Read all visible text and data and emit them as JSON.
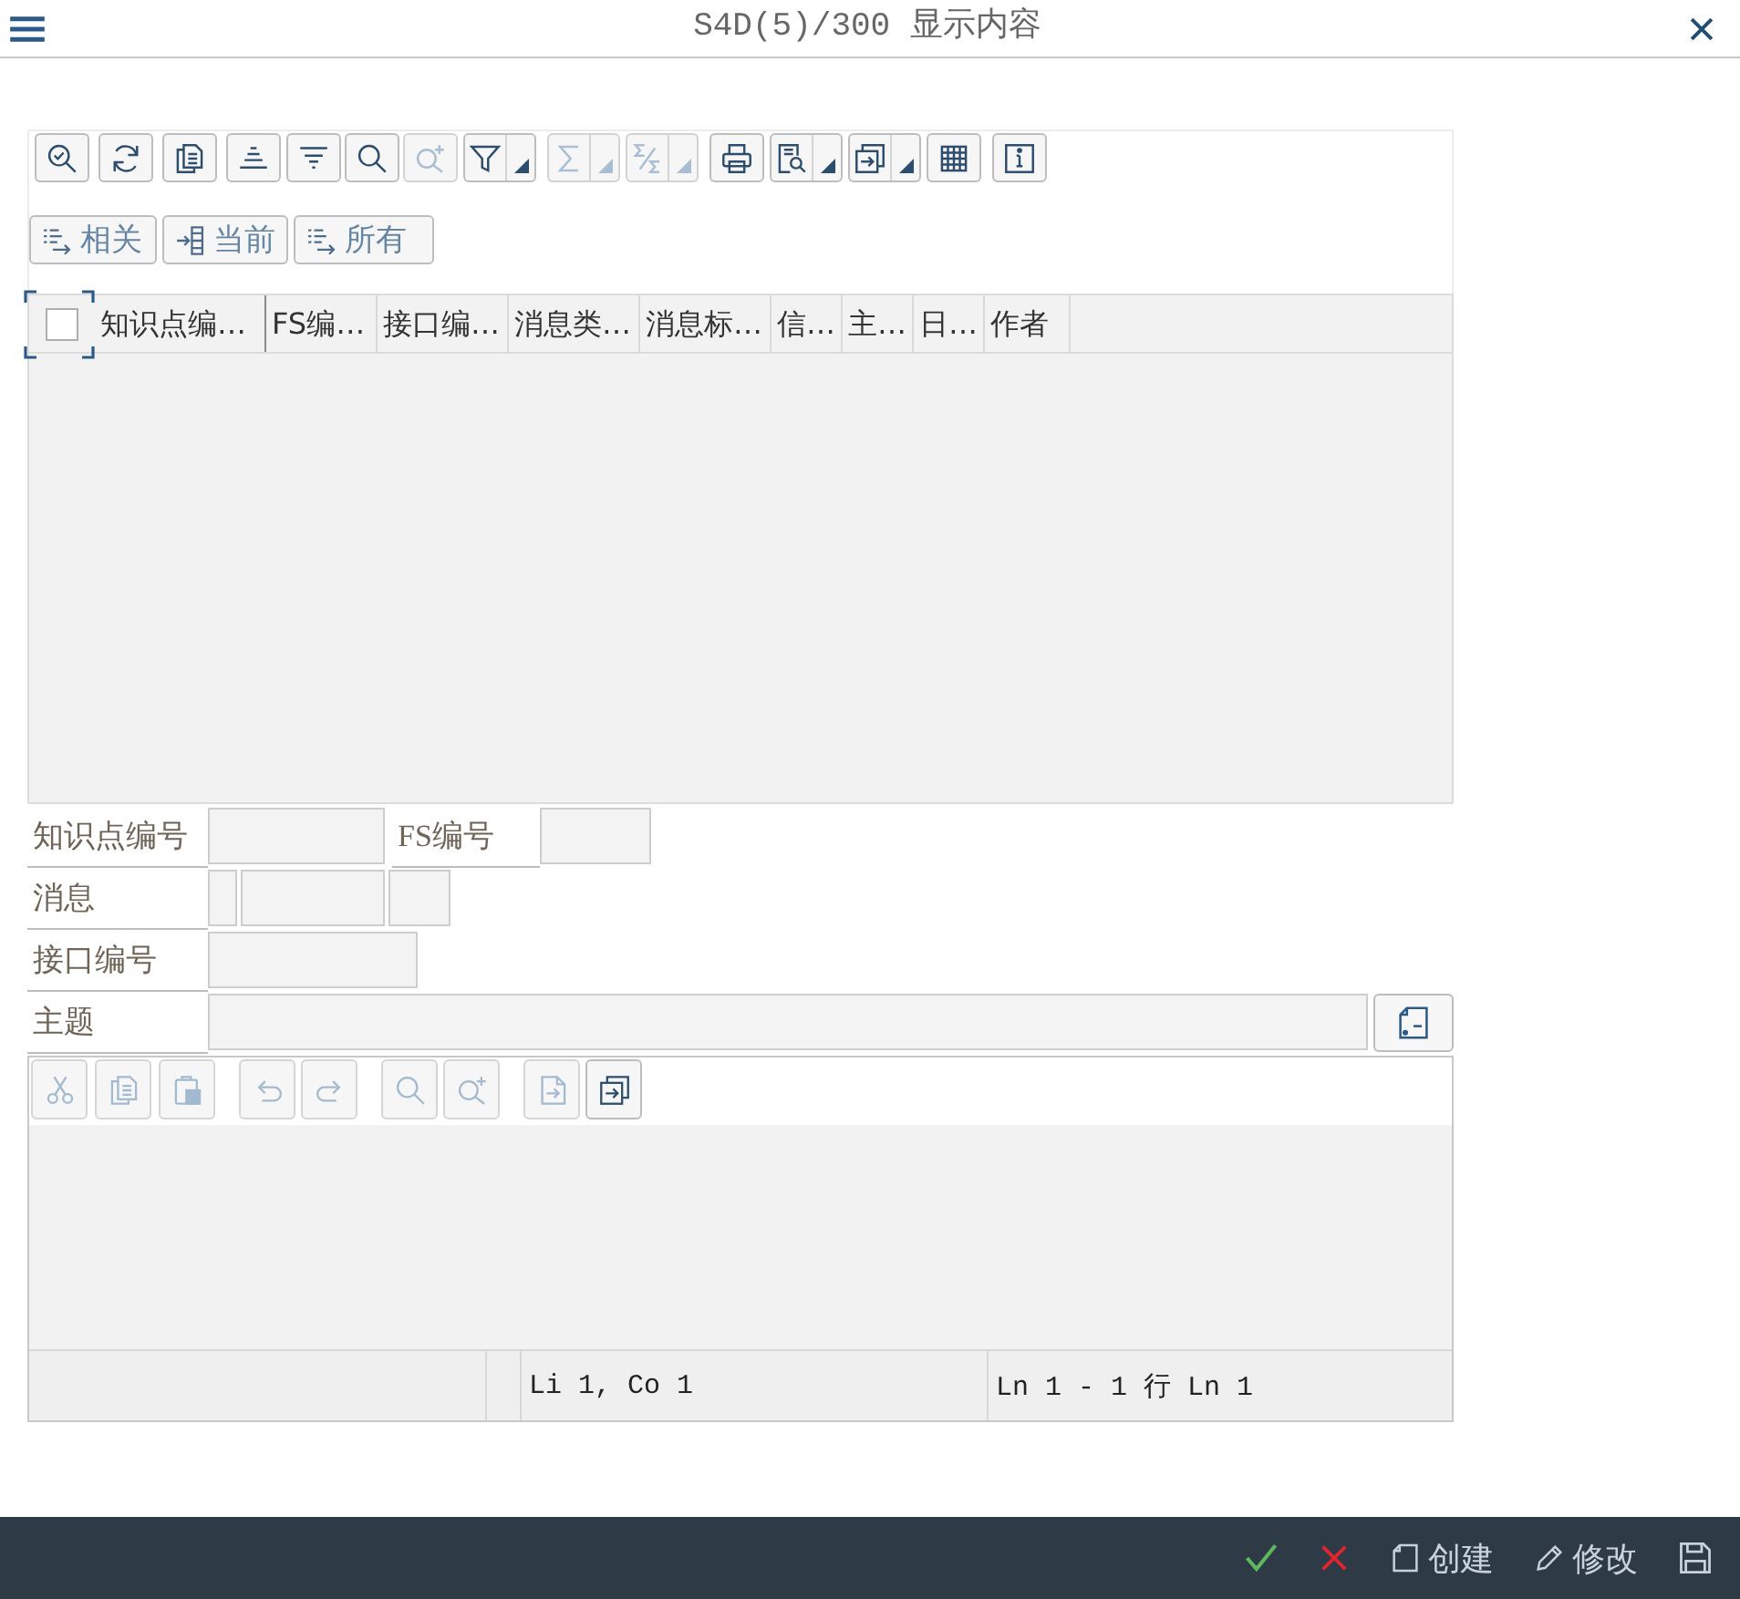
{
  "window": {
    "title": "S4D(5)/300 显示内容"
  },
  "toolbar": [
    {
      "kind": "button",
      "disabled": false
    },
    {
      "kind": "button",
      "disabled": false
    },
    {
      "kind": "button",
      "disabled": false
    },
    {
      "kind": "button",
      "disabled": false
    },
    {
      "kind": "button",
      "disabled": false
    },
    {
      "kind": "button",
      "disabled": false
    },
    {
      "kind": "button",
      "disabled": true
    },
    {
      "kind": "split",
      "disabled": false
    },
    {
      "kind": "split",
      "disabled": true
    },
    {
      "kind": "split",
      "disabled": true
    },
    {
      "kind": "button",
      "disabled": false
    },
    {
      "kind": "split",
      "disabled": false
    },
    {
      "kind": "split",
      "disabled": false
    },
    {
      "kind": "button",
      "disabled": false
    },
    {
      "kind": "button",
      "disabled": false
    }
  ],
  "view_buttons": [
    {
      "label": "相关"
    },
    {
      "label": "当前"
    },
    {
      "label": "所有"
    }
  ],
  "table": {
    "select_all": {
      "checked": false
    },
    "columns": [
      "知识点编…",
      "FS编…",
      "接口编…",
      "消息类…",
      "消息标…",
      "信…",
      "主…",
      "日…",
      "作者"
    ]
  },
  "form": {
    "rows": [
      [
        {
          "label": "知识点编号"
        },
        {
          "label": "FS编号"
        }
      ],
      [
        {
          "label": "消息"
        }
      ],
      [
        {
          "label": "接口编号"
        }
      ],
      [
        {
          "label": "主题"
        }
      ]
    ]
  },
  "editor": {
    "toolbar": [
      {
        "disabled": true
      },
      {
        "disabled": true
      },
      {
        "disabled": true
      },
      {
        "disabled": true
      },
      {
        "disabled": true
      },
      {
        "disabled": true
      },
      {
        "disabled": true
      },
      {
        "disabled": true
      },
      {
        "disabled": false
      }
    ],
    "status": [
      "Li 1, Co 1",
      "Ln 1 - 1 行 Ln 1"
    ]
  },
  "footer": {
    "actions": [
      {
        "kind": "icon"
      },
      {
        "kind": "icon"
      },
      {
        "kind": "labeled",
        "label": "创建"
      },
      {
        "kind": "labeled",
        "label": "修改"
      },
      {
        "kind": "icon"
      }
    ]
  }
}
